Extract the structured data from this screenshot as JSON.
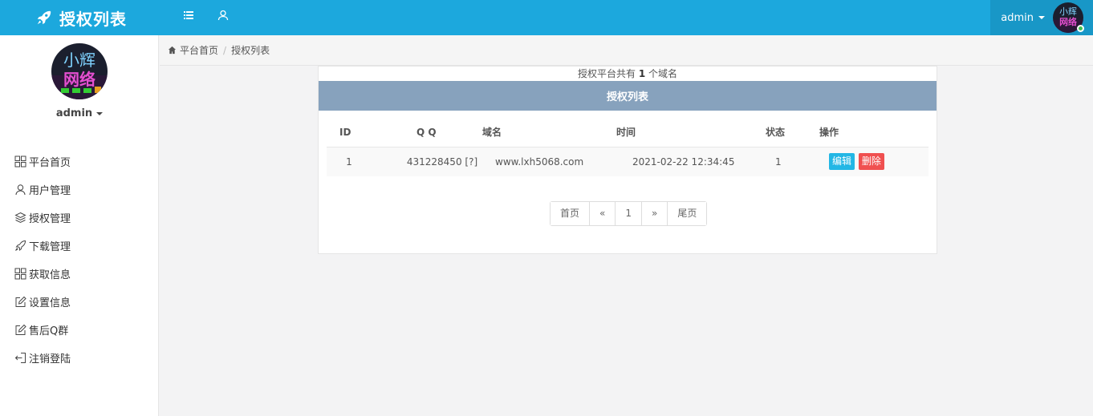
{
  "header": {
    "title": "授权列表",
    "user": "admin",
    "avatar_text": "小辉网络"
  },
  "sidebar": {
    "username": "admin",
    "items": [
      {
        "label": "平台首页",
        "icon": "grid-icon"
      },
      {
        "label": "用户管理",
        "icon": "user-icon"
      },
      {
        "label": "授权管理",
        "icon": "layers-icon"
      },
      {
        "label": "下载管理",
        "icon": "rocket-icon"
      },
      {
        "label": "获取信息",
        "icon": "grid-icon"
      },
      {
        "label": "设置信息",
        "icon": "edit-icon"
      },
      {
        "label": "售后Q群",
        "icon": "edit-icon"
      },
      {
        "label": "注销登陆",
        "icon": "logout-icon"
      }
    ]
  },
  "breadcrumb": {
    "home": "平台首页",
    "current": "授权列表"
  },
  "panel": {
    "count_prefix": "授权平台共有",
    "count": "1",
    "count_suffix": "个域名",
    "heading": "授权列表"
  },
  "table": {
    "headers": [
      "ID",
      "Q Q",
      "域名",
      "时间",
      "状态",
      "操作"
    ],
    "rows": [
      {
        "id": "1",
        "qq": "431228450 [?]",
        "domain": "www.lxh5068.com",
        "time": "2021-02-22 12:34:45",
        "status": "1",
        "edit": "编辑",
        "delete": "删除"
      }
    ]
  },
  "pagination": {
    "first": "首页",
    "prev": "«",
    "page": "1",
    "next": "»",
    "last": "尾页"
  },
  "colors": {
    "header": "#1ca8dd",
    "panel_heading": "#87a2bd",
    "edit_button": "#23b7e5",
    "delete_button": "#f05050"
  }
}
